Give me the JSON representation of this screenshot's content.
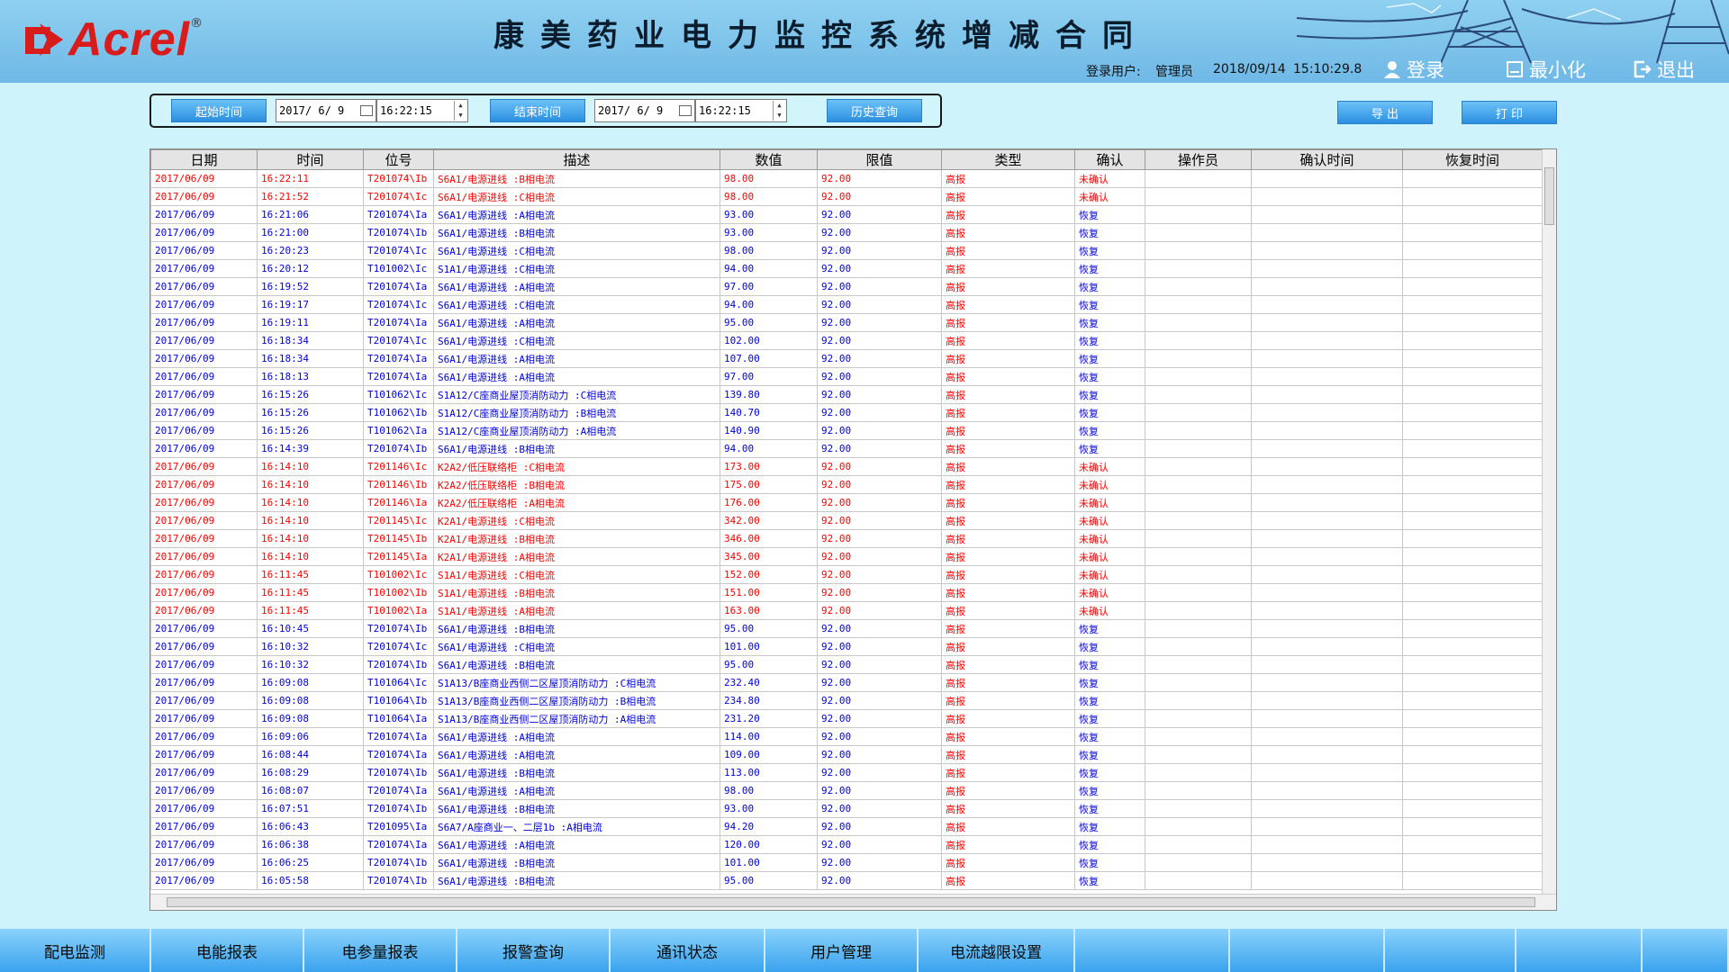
{
  "header": {
    "logo_text": "Acrel",
    "logo_reg": "®",
    "title": "康美药业电力监控系统增减合同",
    "user_label": "登录用户:",
    "user_name": "管理员",
    "date": "2018/09/14",
    "time": "15:10:29.8",
    "login_label": "登录",
    "minimize_label": "最小化",
    "exit_label": "退出"
  },
  "query": {
    "start_btn": "起始时间",
    "start_date": "2017/ 6/ 9",
    "start_time": "16:22:15",
    "end_btn": "结束时间",
    "end_date": "2017/ 6/ 9",
    "end_time": "16:22:15",
    "history_btn": "历史查询",
    "export_btn": "导 出",
    "print_btn": "打 印"
  },
  "table": {
    "columns": [
      "日期",
      "时间",
      "位号",
      "描述",
      "数值",
      "限值",
      "类型",
      "确认",
      "操作员",
      "确认时间",
      "恢复时间"
    ],
    "rows": [
      [
        "2017/06/09",
        "16:22:11",
        "T201074\\Ib",
        "S6A1/电源进线 :B相电流",
        "98.00",
        "92.00",
        "高报",
        "未确认"
      ],
      [
        "2017/06/09",
        "16:21:52",
        "T201074\\Ic",
        "S6A1/电源进线 :C相电流",
        "98.00",
        "92.00",
        "高报",
        "未确认"
      ],
      [
        "2017/06/09",
        "16:21:06",
        "T201074\\Ia",
        "S6A1/电源进线 :A相电流",
        "93.00",
        "92.00",
        "高报",
        "恢复"
      ],
      [
        "2017/06/09",
        "16:21:00",
        "T201074\\Ib",
        "S6A1/电源进线 :B相电流",
        "93.00",
        "92.00",
        "高报",
        "恢复"
      ],
      [
        "2017/06/09",
        "16:20:23",
        "T201074\\Ic",
        "S6A1/电源进线 :C相电流",
        "98.00",
        "92.00",
        "高报",
        "恢复"
      ],
      [
        "2017/06/09",
        "16:20:12",
        "T101002\\Ic",
        "S1A1/电源进线 :C相电流",
        "94.00",
        "92.00",
        "高报",
        "恢复"
      ],
      [
        "2017/06/09",
        "16:19:52",
        "T201074\\Ia",
        "S6A1/电源进线 :A相电流",
        "97.00",
        "92.00",
        "高报",
        "恢复"
      ],
      [
        "2017/06/09",
        "16:19:17",
        "T201074\\Ic",
        "S6A1/电源进线 :C相电流",
        "94.00",
        "92.00",
        "高报",
        "恢复"
      ],
      [
        "2017/06/09",
        "16:19:11",
        "T201074\\Ia",
        "S6A1/电源进线 :A相电流",
        "95.00",
        "92.00",
        "高报",
        "恢复"
      ],
      [
        "2017/06/09",
        "16:18:34",
        "T201074\\Ic",
        "S6A1/电源进线 :C相电流",
        "102.00",
        "92.00",
        "高报",
        "恢复"
      ],
      [
        "2017/06/09",
        "16:18:34",
        "T201074\\Ia",
        "S6A1/电源进线 :A相电流",
        "107.00",
        "92.00",
        "高报",
        "恢复"
      ],
      [
        "2017/06/09",
        "16:18:13",
        "T201074\\Ia",
        "S6A1/电源进线 :A相电流",
        "97.00",
        "92.00",
        "高报",
        "恢复"
      ],
      [
        "2017/06/09",
        "16:15:26",
        "T101062\\Ic",
        "S1A12/C座商业屋顶消防动力 :C相电流",
        "139.80",
        "92.00",
        "高报",
        "恢复"
      ],
      [
        "2017/06/09",
        "16:15:26",
        "T101062\\Ib",
        "S1A12/C座商业屋顶消防动力 :B相电流",
        "140.70",
        "92.00",
        "高报",
        "恢复"
      ],
      [
        "2017/06/09",
        "16:15:26",
        "T101062\\Ia",
        "S1A12/C座商业屋顶消防动力 :A相电流",
        "140.90",
        "92.00",
        "高报",
        "恢复"
      ],
      [
        "2017/06/09",
        "16:14:39",
        "T201074\\Ib",
        "S6A1/电源进线 :B相电流",
        "94.00",
        "92.00",
        "高报",
        "恢复"
      ],
      [
        "2017/06/09",
        "16:14:10",
        "T201146\\Ic",
        "K2A2/低压联络柜 :C相电流",
        "173.00",
        "92.00",
        "高报",
        "未确认"
      ],
      [
        "2017/06/09",
        "16:14:10",
        "T201146\\Ib",
        "K2A2/低压联络柜 :B相电流",
        "175.00",
        "92.00",
        "高报",
        "未确认"
      ],
      [
        "2017/06/09",
        "16:14:10",
        "T201146\\Ia",
        "K2A2/低压联络柜 :A相电流",
        "176.00",
        "92.00",
        "高报",
        "未确认"
      ],
      [
        "2017/06/09",
        "16:14:10",
        "T201145\\Ic",
        "K2A1/电源进线 :C相电流",
        "342.00",
        "92.00",
        "高报",
        "未确认"
      ],
      [
        "2017/06/09",
        "16:14:10",
        "T201145\\Ib",
        "K2A1/电源进线 :B相电流",
        "346.00",
        "92.00",
        "高报",
        "未确认"
      ],
      [
        "2017/06/09",
        "16:14:10",
        "T201145\\Ia",
        "K2A1/电源进线 :A相电流",
        "345.00",
        "92.00",
        "高报",
        "未确认"
      ],
      [
        "2017/06/09",
        "16:11:45",
        "T101002\\Ic",
        "S1A1/电源进线 :C相电流",
        "152.00",
        "92.00",
        "高报",
        "未确认"
      ],
      [
        "2017/06/09",
        "16:11:45",
        "T101002\\Ib",
        "S1A1/电源进线 :B相电流",
        "151.00",
        "92.00",
        "高报",
        "未确认"
      ],
      [
        "2017/06/09",
        "16:11:45",
        "T101002\\Ia",
        "S1A1/电源进线 :A相电流",
        "163.00",
        "92.00",
        "高报",
        "未确认"
      ],
      [
        "2017/06/09",
        "16:10:45",
        "T201074\\Ib",
        "S6A1/电源进线 :B相电流",
        "95.00",
        "92.00",
        "高报",
        "恢复"
      ],
      [
        "2017/06/09",
        "16:10:32",
        "T201074\\Ic",
        "S6A1/电源进线 :C相电流",
        "101.00",
        "92.00",
        "高报",
        "恢复"
      ],
      [
        "2017/06/09",
        "16:10:32",
        "T201074\\Ib",
        "S6A1/电源进线 :B相电流",
        "95.00",
        "92.00",
        "高报",
        "恢复"
      ],
      [
        "2017/06/09",
        "16:09:08",
        "T101064\\Ic",
        "S1A13/B座商业西侧二区屋顶消防动力 :C相电流",
        "232.40",
        "92.00",
        "高报",
        "恢复"
      ],
      [
        "2017/06/09",
        "16:09:08",
        "T101064\\Ib",
        "S1A13/B座商业西侧二区屋顶消防动力 :B相电流",
        "234.80",
        "92.00",
        "高报",
        "恢复"
      ],
      [
        "2017/06/09",
        "16:09:08",
        "T101064\\Ia",
        "S1A13/B座商业西侧二区屋顶消防动力 :A相电流",
        "231.20",
        "92.00",
        "高报",
        "恢复"
      ],
      [
        "2017/06/09",
        "16:09:06",
        "T201074\\Ia",
        "S6A1/电源进线 :A相电流",
        "114.00",
        "92.00",
        "高报",
        "恢复"
      ],
      [
        "2017/06/09",
        "16:08:44",
        "T201074\\Ia",
        "S6A1/电源进线 :A相电流",
        "109.00",
        "92.00",
        "高报",
        "恢复"
      ],
      [
        "2017/06/09",
        "16:08:29",
        "T201074\\Ib",
        "S6A1/电源进线 :B相电流",
        "113.00",
        "92.00",
        "高报",
        "恢复"
      ],
      [
        "2017/06/09",
        "16:08:07",
        "T201074\\Ia",
        "S6A1/电源进线 :A相电流",
        "98.00",
        "92.00",
        "高报",
        "恢复"
      ],
      [
        "2017/06/09",
        "16:07:51",
        "T201074\\Ib",
        "S6A1/电源进线 :B相电流",
        "93.00",
        "92.00",
        "高报",
        "恢复"
      ],
      [
        "2017/06/09",
        "16:06:43",
        "T201095\\Ia",
        "S6A7/A座商业一、二层1b :A相电流",
        "94.20",
        "92.00",
        "高报",
        "恢复"
      ],
      [
        "2017/06/09",
        "16:06:38",
        "T201074\\Ia",
        "S6A1/电源进线 :A相电流",
        "120.00",
        "92.00",
        "高报",
        "恢复"
      ],
      [
        "2017/06/09",
        "16:06:25",
        "T201074\\Ib",
        "S6A1/电源进线 :B相电流",
        "101.00",
        "92.00",
        "高报",
        "恢复"
      ],
      [
        "2017/06/09",
        "16:05:58",
        "T201074\\Ib",
        "S6A1/电源进线 :B相电流",
        "95.00",
        "92.00",
        "高报",
        "恢复"
      ]
    ]
  },
  "nav": {
    "items": [
      "配电监测",
      "电能报表",
      "电参量报表",
      "报警查询",
      "通讯状态",
      "用户管理",
      "电流越限设置",
      "",
      "",
      "",
      "",
      ""
    ]
  },
  "colors": {
    "unconfirmed": "#ff0000",
    "recovered": "#0000e0",
    "accent": "#2b8fe0"
  }
}
